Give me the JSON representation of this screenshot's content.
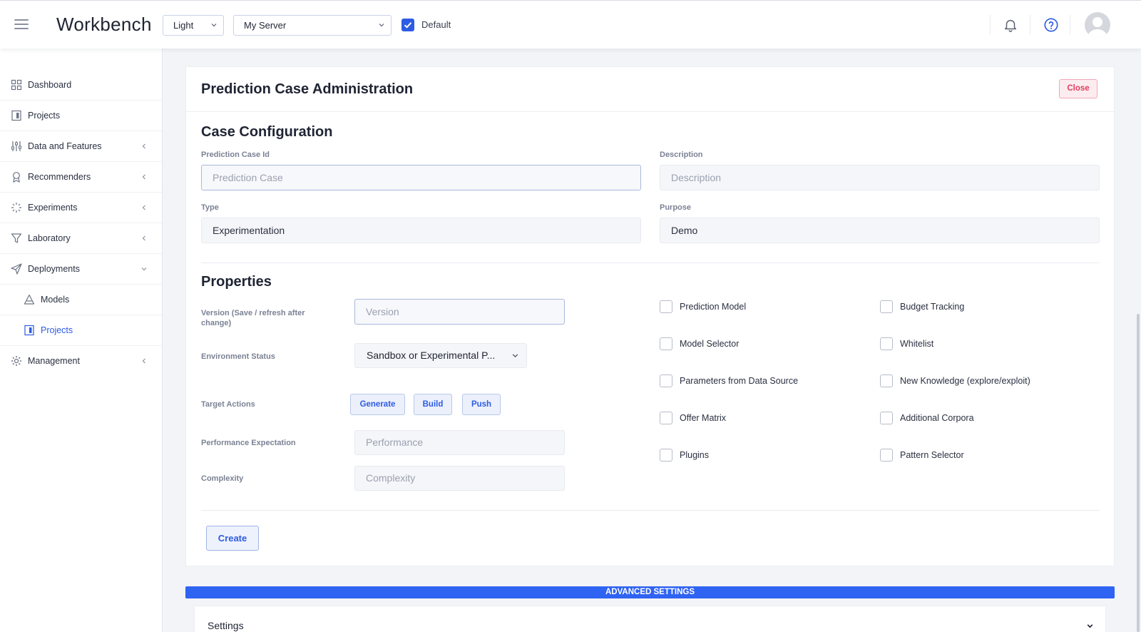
{
  "header": {
    "app_title": "Workbench",
    "theme_select": "Light",
    "server_select": "My Server",
    "default_label": "Default",
    "default_checked": true
  },
  "sidebar": {
    "items": [
      {
        "label": "Dashboard",
        "icon": "grid-icon"
      },
      {
        "label": "Projects",
        "icon": "book-icon"
      },
      {
        "label": "Data and Features",
        "icon": "sliders-icon"
      },
      {
        "label": "Recommenders",
        "icon": "award-icon"
      },
      {
        "label": "Experiments",
        "icon": "loader-icon"
      },
      {
        "label": "Laboratory",
        "icon": "filter-icon"
      },
      {
        "label": "Deployments",
        "icon": "send-icon"
      },
      {
        "label": "Models",
        "icon": "triangle-icon"
      },
      {
        "label": "Projects",
        "icon": "book-icon"
      },
      {
        "label": "Management",
        "icon": "gear-icon"
      }
    ]
  },
  "card": {
    "title": "Prediction Case Administration",
    "close_label": "Close",
    "config_title": "Case Configuration",
    "case_id_label": "Prediction Case Id",
    "case_id_placeholder": "Prediction Case",
    "description_label": "Description",
    "description_placeholder": "Description",
    "type_label": "Type",
    "type_value": "Experimentation",
    "purpose_label": "Purpose",
    "purpose_value": "Demo",
    "properties_title": "Properties",
    "version_label": "Version (Save / refresh after change)",
    "version_placeholder": "Version",
    "env_label": "Environment Status",
    "env_value": "Sandbox or Experimental P...",
    "target_label": "Target Actions",
    "actions": [
      "Generate",
      "Build",
      "Push"
    ],
    "performance_label": "Performance Expectation",
    "performance_placeholder": "Performance",
    "complexity_label": "Complexity",
    "complexity_placeholder": "Complexity",
    "checkboxes_left": [
      "Prediction Model",
      "Model Selector",
      "Parameters from Data Source",
      "Offer Matrix",
      "Plugins"
    ],
    "checkboxes_right": [
      "Budget Tracking",
      "Whitelist",
      "New Knowledge (explore/exploit)",
      "Additional Corpora",
      "Pattern Selector"
    ],
    "create_label": "Create"
  },
  "advanced": {
    "bar_label": "ADVANCED SETTINGS",
    "settings_label": "Settings"
  },
  "colors": {
    "accent": "#2d5be3",
    "advanced_bar": "#2f63f2",
    "close": "#e23d5f"
  }
}
